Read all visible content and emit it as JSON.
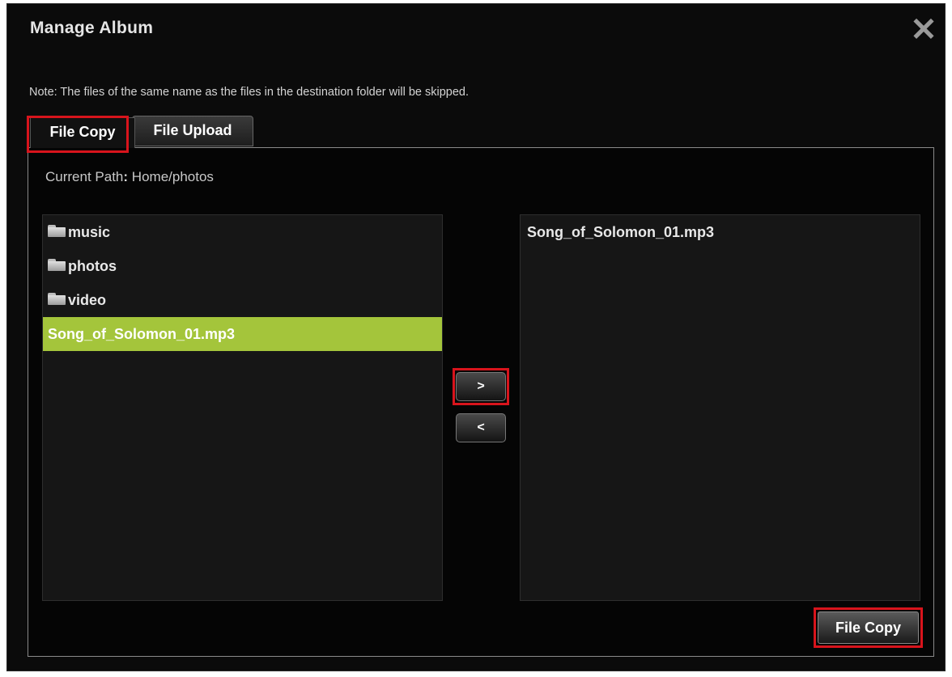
{
  "dialog": {
    "title": "Manage Album",
    "close_glyph": "✕",
    "note": "Note: The files of the same name as the files in the destination folder will be skipped."
  },
  "tabs": [
    {
      "label": "File Copy",
      "active": true,
      "highlighted": true
    },
    {
      "label": "File Upload",
      "active": false,
      "highlighted": false
    }
  ],
  "current_path": {
    "label": "Current Path",
    "separator": ":",
    "value": "Home/photos"
  },
  "source_list": {
    "items": [
      {
        "label": "music",
        "type": "folder",
        "icon": "folder-icon",
        "selected": false
      },
      {
        "label": "photos",
        "type": "folder",
        "icon": "folder-icon",
        "selected": false
      },
      {
        "label": "video",
        "type": "folder",
        "icon": "folder-icon",
        "selected": false
      },
      {
        "label": "Song_of_Solomon_01.mp3",
        "type": "file",
        "selected": true
      }
    ]
  },
  "destination_list": {
    "items": [
      {
        "label": "Song_of_Solomon_01.mp3"
      }
    ]
  },
  "transfer_buttons": {
    "add_label": ">",
    "remove_label": "<"
  },
  "action": {
    "file_copy_label": "File Copy"
  },
  "colors": {
    "background": "#0b0b0b",
    "selected_row": "#a4c53b",
    "highlight_outline": "#d8141c"
  }
}
